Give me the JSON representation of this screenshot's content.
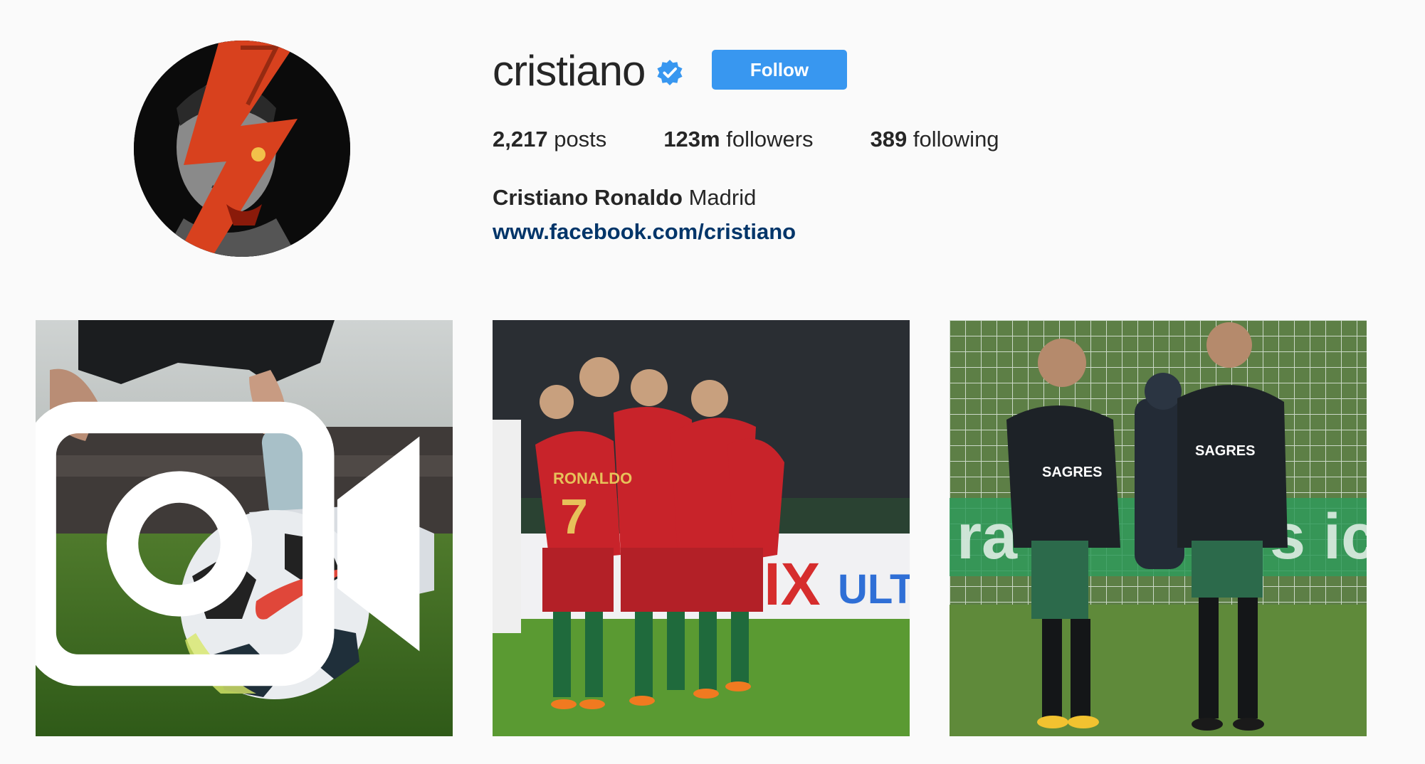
{
  "profile": {
    "username": "cristiano",
    "verified": true,
    "follow_label": "Follow",
    "stats": {
      "posts_count": "2,217",
      "posts_label": "posts",
      "followers_count": "123m",
      "followers_label": "followers",
      "following_count": "389",
      "following_label": "following"
    },
    "full_name": "Cristiano Ronaldo",
    "bio": "Madrid",
    "website": "www.facebook.com/cristiano"
  },
  "posts": [
    {
      "type": "video",
      "icon": "video-icon"
    },
    {
      "type": "photo"
    },
    {
      "type": "photo"
    }
  ],
  "colors": {
    "background": "#fafafa",
    "follow_button": "#3897f0",
    "link": "#003569",
    "verified_badge": "#3897f0"
  }
}
